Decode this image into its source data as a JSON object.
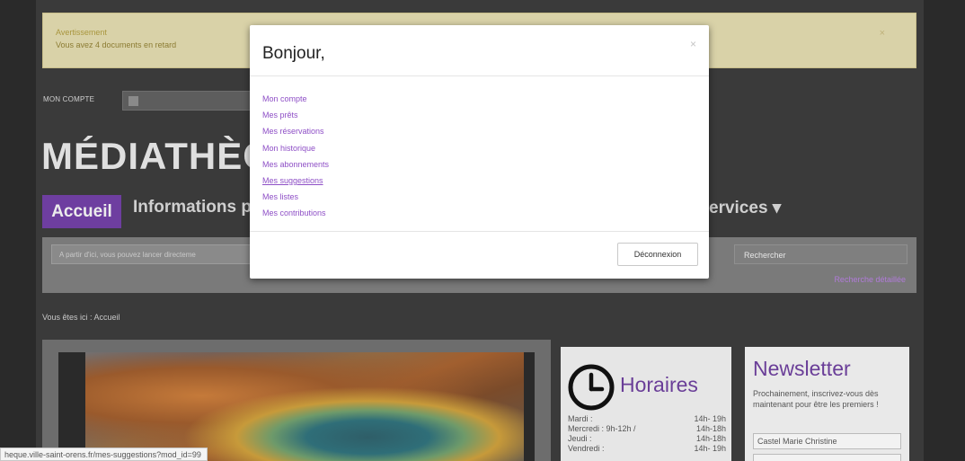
{
  "alert": {
    "title": "Avertissement",
    "message": "Vous avez 4 documents en retard",
    "close": "×"
  },
  "account": {
    "label": "MON COMPTE"
  },
  "site": {
    "title": "MÉDIATHÈQ"
  },
  "nav": {
    "home": "Accueil",
    "info": "Informations p",
    "services": "ervices ▾"
  },
  "search": {
    "placeholder": "A partir d'ici, vous pouvez lancer directeme",
    "button": "Rechercher",
    "advanced": "Recherche détaillée"
  },
  "breadcrumb": "Vous êtes ici :  Accueil",
  "horaires": {
    "title": "Horaires",
    "rows": [
      {
        "day": "Mardi :",
        "hours": "14h- 19h"
      },
      {
        "day": "Mercredi : 9h-12h /",
        "hours": "14h-18h"
      },
      {
        "day": "Jeudi :",
        "hours": "14h-18h"
      },
      {
        "day": "Vendredi :",
        "hours": "14h- 19h"
      }
    ]
  },
  "newsletter": {
    "title": "Newsletter",
    "text": "Prochainement, inscrivez-vous dès maintenant pour être les premiers !",
    "name_value": "Castel Marie Christine"
  },
  "statusbar": {
    "url": "heque.ville-saint-orens.fr/mes-suggestions?mod_id=99"
  },
  "modal": {
    "title": "Bonjour,",
    "close": "×",
    "links": [
      "Mon compte",
      "Mes prêts",
      "Mes réservations",
      "Mon historique",
      "Mes abonnements",
      "Mes suggestions",
      "Mes listes",
      "Mes contributions"
    ],
    "logout": "Déconnexion"
  },
  "colors": {
    "accent": "#6e3ea0",
    "link": "#8e4fc6",
    "backdrop": "#3a3a3a"
  }
}
